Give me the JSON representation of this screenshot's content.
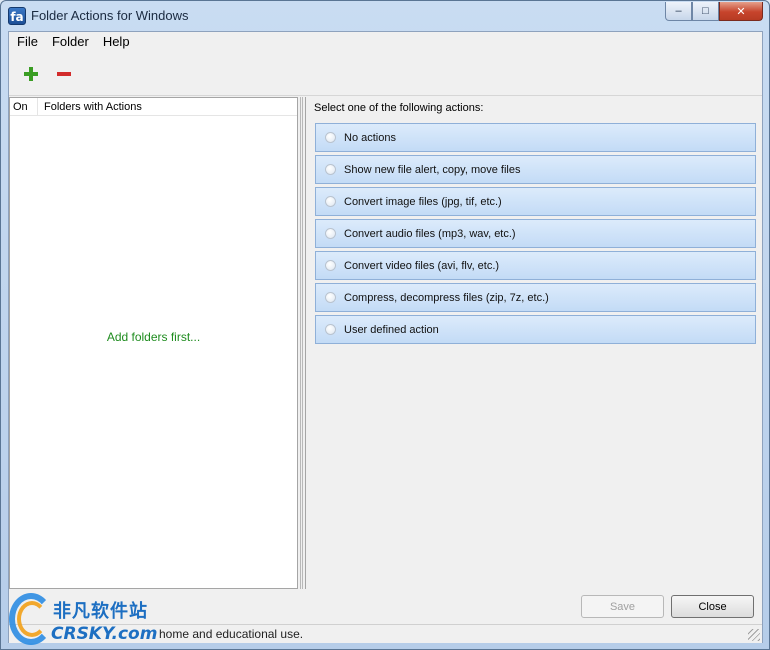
{
  "window": {
    "app_icon_text": "fa",
    "title": "Folder Actions for Windows",
    "minimize": "–",
    "maximize": "□",
    "close": "✕"
  },
  "menu": {
    "items": [
      "File",
      "Folder",
      "Help"
    ]
  },
  "toolbar": {
    "add_icon": "plus-icon",
    "remove_icon": "minus-icon",
    "add_color": "#3a9d23",
    "remove_color": "#d22b2b"
  },
  "folders_list": {
    "columns": [
      "On",
      "Folders with Actions"
    ],
    "empty_message": "Add folders first..."
  },
  "actions_panel": {
    "prompt": "Select one of the following actions:",
    "options": [
      "No actions",
      "Show new file alert, copy, move files",
      "Convert image files (jpg, tif, etc.)",
      "Convert audio files (mp3, wav, etc.)",
      "Convert video files (avi, flv, etc.)",
      "Compress, decompress files (zip, 7z, etc.)",
      "User defined action"
    ]
  },
  "buttons": {
    "save": "Save",
    "close": "Close"
  },
  "status": {
    "text": "home and educational use."
  },
  "watermark": {
    "cn": "非凡软件站",
    "en": "CRSKY.com"
  }
}
